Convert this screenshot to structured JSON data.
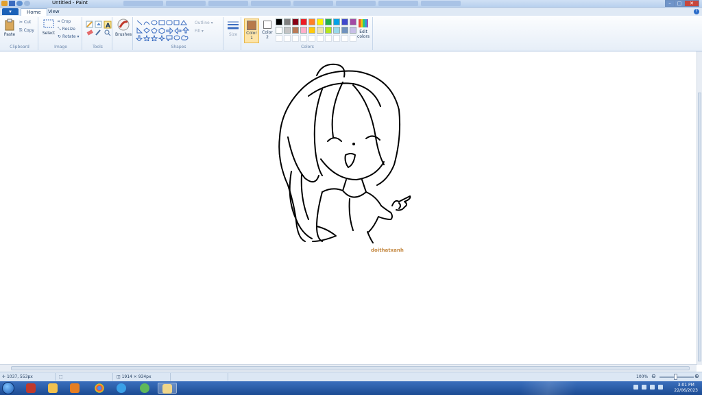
{
  "window": {
    "title": "Untitled - Paint",
    "controls": {
      "minimize": "–",
      "maximize": "□",
      "close": "✕"
    }
  },
  "ribbon_tabs": {
    "file": "▾",
    "home": "Home",
    "view": "View"
  },
  "clipboard": {
    "paste": "Paste",
    "cut": "Cut",
    "copy": "Copy",
    "label": "Clipboard"
  },
  "image": {
    "select": "Select",
    "crop": "Crop",
    "resize": "Resize",
    "rotate": "Rotate ▾",
    "label": "Image"
  },
  "tools": {
    "label": "Tools"
  },
  "brushes": {
    "label": "Brushes"
  },
  "shapes": {
    "outline": "Outline ▾",
    "fill": "Fill ▾",
    "label": "Shapes"
  },
  "size": {
    "label": "Size"
  },
  "colors": {
    "color1_line1": "Color",
    "color1_line2": "1",
    "color2_line1": "Color",
    "color2_line2": "2",
    "edit_line1": "Edit",
    "edit_line2": "colors",
    "label": "Colors",
    "color1_value": "#b87a4a",
    "color2_value": "#ffffff",
    "palette_row1": [
      "#000000",
      "#7f7f7f",
      "#880015",
      "#ed1c24",
      "#ff7f27",
      "#fff200",
      "#22b14c",
      "#00a2e8",
      "#3f48cc",
      "#a349a4"
    ],
    "palette_row2": [
      "#ffffff",
      "#c3c3c3",
      "#b97a57",
      "#ffaec9",
      "#ffc90e",
      "#efe4b0",
      "#b5e61d",
      "#99d9ea",
      "#7092be",
      "#c8bfe7"
    ]
  },
  "canvas": {
    "signature": "doithatxanh"
  },
  "status": {
    "cursor_pos": "1037, 553px",
    "canvas_size": "1914 × 934px",
    "zoom": "100%"
  },
  "taskbar": {
    "time": "3:01 PM",
    "date": "22/06/2023"
  }
}
